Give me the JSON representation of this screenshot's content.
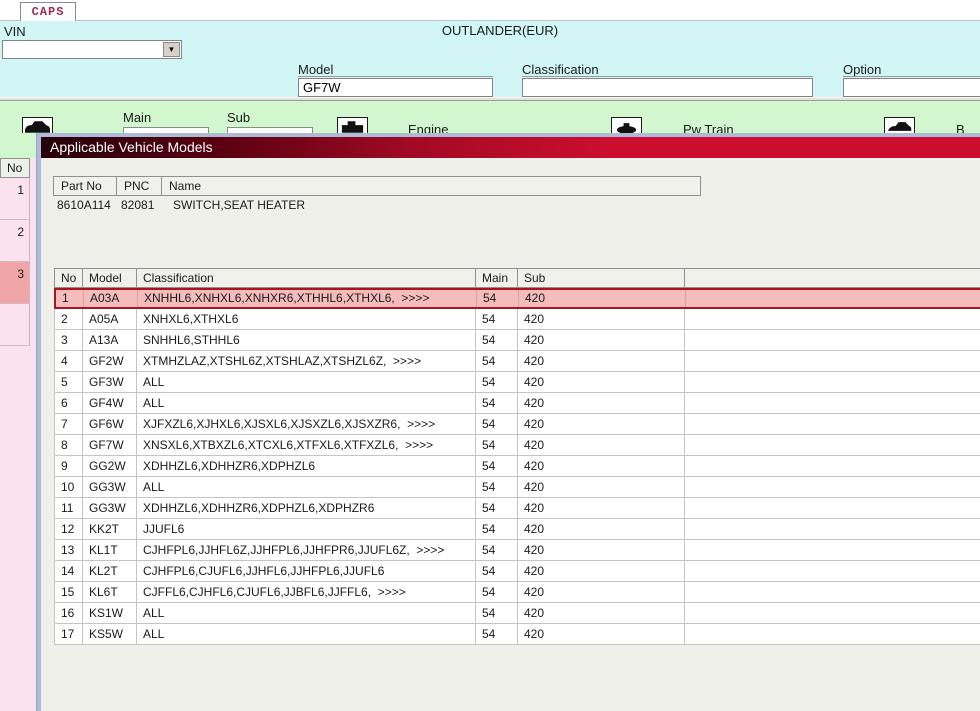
{
  "window": {
    "tab_label": "CAPS",
    "vin_label": "VIN",
    "vin_value": "",
    "title": "OUTLANDER(EUR)",
    "dropdown_glyph": "▼",
    "fields": {
      "model": {
        "label": "Model",
        "value": "GF7W"
      },
      "classification": {
        "label": "Classification",
        "value": ""
      },
      "option": {
        "label": "Option",
        "value": ""
      }
    },
    "toolbar": {
      "main_label": "Main",
      "sub_label": "Sub",
      "engine_label": "Engine",
      "pwtrain_label": "Pw Train",
      "body_label": "B"
    },
    "left_panel": {
      "header": "No",
      "rows": [
        "1",
        "2",
        "3"
      ],
      "selected_index": 2
    }
  },
  "dialog": {
    "title": "Applicable Vehicle Models",
    "part_table": {
      "headers": [
        "Part No",
        "PNC",
        "Name"
      ],
      "row": {
        "part_no": "8610A114",
        "pnc": "82081",
        "name": "SWITCH,SEAT HEATER"
      }
    },
    "model_table": {
      "headers": [
        "No",
        "Model",
        "Classification",
        "Main",
        "Sub",
        ""
      ],
      "rows": [
        {
          "no": "1",
          "model": "A03A",
          "classification": "XNHHL6,XNHXL6,XNHXR6,XTHHL6,XTHXL6,  >>>>",
          "main": "54",
          "sub": "420",
          "highlighted": true
        },
        {
          "no": "2",
          "model": "A05A",
          "classification": "XNHXL6,XTHXL6",
          "main": "54",
          "sub": "420",
          "highlighted": false
        },
        {
          "no": "3",
          "model": "A13A",
          "classification": "SNHHL6,STHHL6",
          "main": "54",
          "sub": "420",
          "highlighted": false
        },
        {
          "no": "4",
          "model": "GF2W",
          "classification": "XTMHZLAZ,XTSHL6Z,XTSHLAZ,XTSHZL6Z,  >>>>",
          "main": "54",
          "sub": "420",
          "highlighted": false
        },
        {
          "no": "5",
          "model": "GF3W",
          "classification": "ALL",
          "main": "54",
          "sub": "420",
          "highlighted": false
        },
        {
          "no": "6",
          "model": "GF4W",
          "classification": "ALL",
          "main": "54",
          "sub": "420",
          "highlighted": false
        },
        {
          "no": "7",
          "model": "GF6W",
          "classification": "XJFXZL6,XJHXL6,XJSXL6,XJSXZL6,XJSXZR6,  >>>>",
          "main": "54",
          "sub": "420",
          "highlighted": false
        },
        {
          "no": "8",
          "model": "GF7W",
          "classification": "XNSXL6,XTBXZL6,XTCXL6,XTFXL6,XTFXZL6,  >>>>",
          "main": "54",
          "sub": "420",
          "highlighted": false
        },
        {
          "no": "9",
          "model": "GG2W",
          "classification": "XDHHZL6,XDHHZR6,XDPHZL6",
          "main": "54",
          "sub": "420",
          "highlighted": false
        },
        {
          "no": "10",
          "model": "GG3W",
          "classification": "ALL",
          "main": "54",
          "sub": "420",
          "highlighted": false
        },
        {
          "no": "11",
          "model": "GG3W",
          "classification": "XDHHZL6,XDHHZR6,XDPHZL6,XDPHZR6",
          "main": "54",
          "sub": "420",
          "highlighted": false
        },
        {
          "no": "12",
          "model": "KK2T",
          "classification": "JJUFL6",
          "main": "54",
          "sub": "420",
          "highlighted": false
        },
        {
          "no": "13",
          "model": "KL1T",
          "classification": "CJHFPL6,JJHFL6Z,JJHFPL6,JJHFPR6,JJUFL6Z,  >>>>",
          "main": "54",
          "sub": "420",
          "highlighted": false
        },
        {
          "no": "14",
          "model": "KL2T",
          "classification": "CJHFPL6,CJUFL6,JJHFL6,JJHFPL6,JJUFL6",
          "main": "54",
          "sub": "420",
          "highlighted": false
        },
        {
          "no": "15",
          "model": "KL6T",
          "classification": "CJFFL6,CJHFL6,CJUFL6,JJBFL6,JJFFL6,  >>>>",
          "main": "54",
          "sub": "420",
          "highlighted": false
        },
        {
          "no": "16",
          "model": "KS1W",
          "classification": "ALL",
          "main": "54",
          "sub": "420",
          "highlighted": false
        },
        {
          "no": "17",
          "model": "KS5W",
          "classification": "ALL",
          "main": "54",
          "sub": "420",
          "highlighted": false
        }
      ]
    }
  },
  "colors": {
    "title_bar_crimson": "#cb0d2e",
    "title_bar_dark": "#26000a",
    "highlight_row_bg": "#f5bcbc",
    "highlight_row_border": "#a81420",
    "header_cyan": "#d2f6f6",
    "toolbar_green": "#d2f6ce",
    "left_panel_pink": "#fce2ee",
    "left_panel_selected": "#f0a6a6",
    "dialog_frame_blue": "#aebbd8",
    "dialog_bg": "#f0f0ea"
  }
}
